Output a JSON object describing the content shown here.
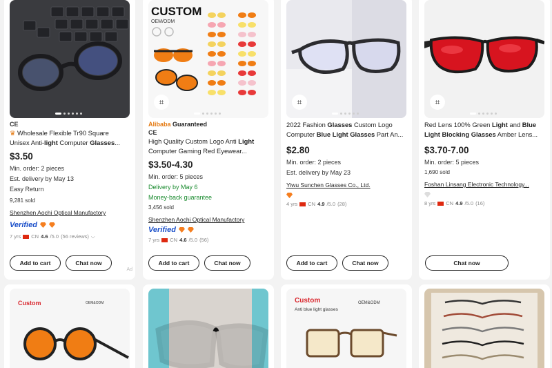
{
  "products": [
    {
      "title_html_parts": [
        "Wholesale Flexible Tr90 Square Unisex Anti-",
        "light",
        " Computer ",
        "Glasses",
        "..."
      ],
      "ce": "CE",
      "price": "$3.50",
      "min_order": "Min. order: 2 pieces",
      "delivery": "Est. delivery by May 13",
      "extra": "Easy Return",
      "sold": "9,281 sold",
      "supplier": "Shenzhen Aochi Optical Manufactory",
      "verified": "Verified",
      "years": "7 yrs",
      "country": "CN",
      "rating": "4.6",
      "rating_max": "/5.0",
      "reviews": "(56 reviews)",
      "add_to_cart": "Add to cart",
      "chat_now": "Chat now",
      "ad": "Ad"
    },
    {
      "assured_brand": "Alibaba",
      "assured_text": "Guaranteed",
      "ce": "CE",
      "title_html_parts": [
        "High Quality Custom Logo Anti ",
        "Light",
        " Computer Gaming Red Eyewear..."
      ],
      "image_text": [
        "CUSTOM",
        "OEM/ODM"
      ],
      "price": "$3.50-4.30",
      "min_order": "Min. order: 5 pieces",
      "delivery": "Delivery by May 6",
      "guarantee": "Money-back guarantee",
      "sold": "3,456 sold",
      "supplier": "Shenzhen Aochi Optical Manufactory",
      "verified": "Verified",
      "years": "7 yrs",
      "country": "CN",
      "rating": "4.6",
      "rating_max": "/5.0",
      "reviews": "(56)",
      "add_to_cart": "Add to cart",
      "chat_now": "Chat now"
    },
    {
      "title_html_parts": [
        "2022 Fashion ",
        "Glasses",
        " Custom Logo Computer ",
        "Blue Light Glasses",
        " Part An..."
      ],
      "price": "$2.80",
      "min_order": "Min. order: 2 pieces",
      "delivery": "Est. delivery by May 23",
      "supplier": "Yiwu Sunchen Glasses Co., Ltd.",
      "years": "4 yrs",
      "country": "CN",
      "rating": "4.9",
      "rating_max": "/5.0",
      "reviews": "(28)",
      "add_to_cart": "Add to cart",
      "chat_now": "Chat now"
    },
    {
      "title_html_parts": [
        "Red Lens 100% Green ",
        "Light",
        " and ",
        "Blue Light Blocking Glasses",
        " Amber Lens..."
      ],
      "price": "$3.70-7.00",
      "min_order": "Min. order: 5 pieces",
      "sold": "1,690 sold",
      "supplier": "Foshan Linsang Electronic Technology...",
      "years": "8 yrs",
      "country": "CN",
      "rating": "4.9",
      "rating_max": "/5.0",
      "reviews": "(16)",
      "chat_now": "Chat now"
    }
  ],
  "row2": [
    {
      "label": "Custom",
      "sub": "OEM&ODM"
    },
    {},
    {
      "label": "Custom",
      "sub": "OEM&ODM",
      "caption": "Anti blue light glasses"
    },
    {}
  ],
  "colors": {
    "accent_orange": "#f57e1f",
    "verified_blue": "#1a4fc9",
    "green": "#188a2d",
    "lens_red": "#d7141f",
    "lens_orange": "#f07d14"
  }
}
